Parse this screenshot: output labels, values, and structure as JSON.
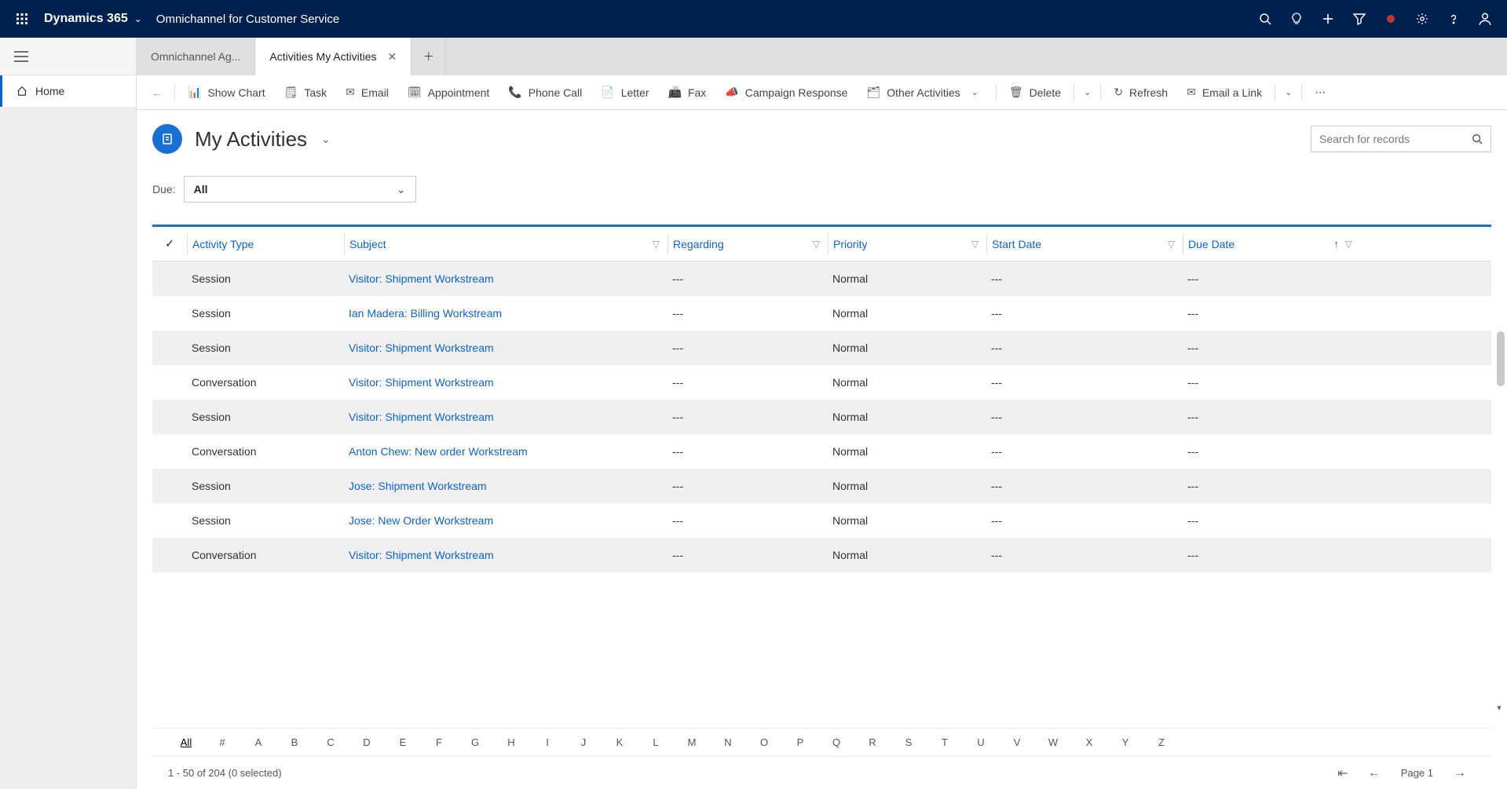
{
  "header": {
    "brand": "Dynamics 365",
    "subtitle": "Omnichannel for Customer Service"
  },
  "tabs": {
    "inactive": "Omnichannel Ag...",
    "active": "Activities My Activities"
  },
  "sidebar": {
    "home": "Home"
  },
  "commands": {
    "show_chart": "Show Chart",
    "task": "Task",
    "email": "Email",
    "appointment": "Appointment",
    "phone_call": "Phone Call",
    "letter": "Letter",
    "fax": "Fax",
    "campaign": "Campaign Response",
    "other": "Other Activities",
    "delete": "Delete",
    "refresh": "Refresh",
    "email_link": "Email a Link"
  },
  "view": {
    "title": "My Activities",
    "search_placeholder": "Search for records",
    "due_label": "Due:",
    "due_value": "All"
  },
  "columns": {
    "type": "Activity Type",
    "subject": "Subject",
    "regarding": "Regarding",
    "priority": "Priority",
    "start": "Start Date",
    "due": "Due Date"
  },
  "rows": [
    {
      "type": "Session",
      "subject": "Visitor: Shipment Workstream",
      "regarding": "---",
      "priority": "Normal",
      "start": "---",
      "due": "---"
    },
    {
      "type": "Session",
      "subject": "Ian Madera: Billing Workstream",
      "regarding": "---",
      "priority": "Normal",
      "start": "---",
      "due": "---"
    },
    {
      "type": "Session",
      "subject": "Visitor: Shipment Workstream",
      "regarding": "---",
      "priority": "Normal",
      "start": "---",
      "due": "---"
    },
    {
      "type": "Conversation",
      "subject": "Visitor: Shipment Workstream",
      "regarding": "---",
      "priority": "Normal",
      "start": "---",
      "due": "---"
    },
    {
      "type": "Session",
      "subject": "Visitor: Shipment Workstream",
      "regarding": "---",
      "priority": "Normal",
      "start": "---",
      "due": "---"
    },
    {
      "type": "Conversation",
      "subject": "Anton Chew: New order Workstream",
      "regarding": "---",
      "priority": "Normal",
      "start": "---",
      "due": "---"
    },
    {
      "type": "Session",
      "subject": "Jose: Shipment Workstream",
      "regarding": "---",
      "priority": "Normal",
      "start": "---",
      "due": "---"
    },
    {
      "type": "Session",
      "subject": "Jose: New Order Workstream",
      "regarding": "---",
      "priority": "Normal",
      "start": "---",
      "due": "---"
    },
    {
      "type": "Conversation",
      "subject": "Visitor: Shipment Workstream",
      "regarding": "---",
      "priority": "Normal",
      "start": "---",
      "due": "---"
    }
  ],
  "alpha": [
    "All",
    "#",
    "A",
    "B",
    "C",
    "D",
    "E",
    "F",
    "G",
    "H",
    "I",
    "J",
    "K",
    "L",
    "M",
    "N",
    "O",
    "P",
    "Q",
    "R",
    "S",
    "T",
    "U",
    "V",
    "W",
    "X",
    "Y",
    "Z"
  ],
  "pager": {
    "status": "1 - 50 of 204 (0 selected)",
    "page": "Page 1"
  }
}
